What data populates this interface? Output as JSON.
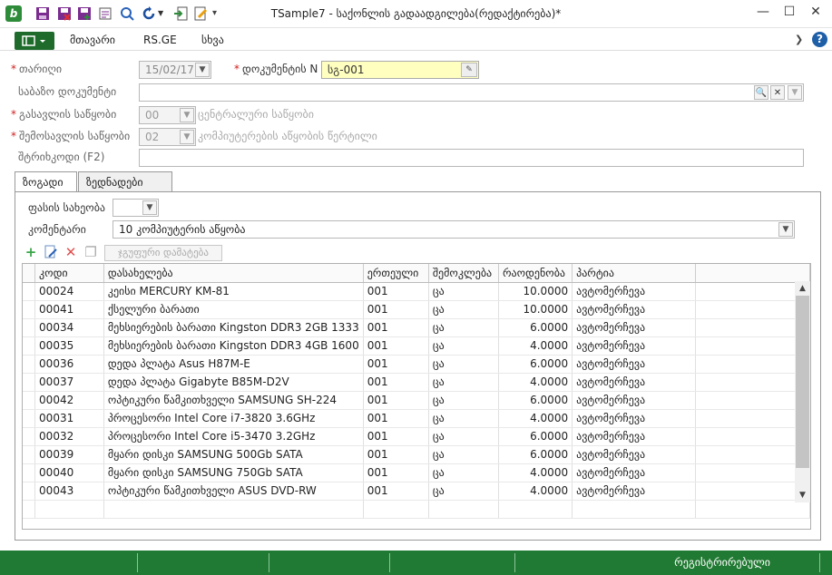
{
  "window": {
    "title": "TSample7 - საქონლის გადაადგილება(რედაქტირება)*"
  },
  "menu": {
    "items": [
      "მთავარი",
      "RS.GE",
      "სხვა"
    ]
  },
  "form": {
    "date_label": "თარიღი",
    "date_value": "15/02/17",
    "docnum_label": "დოკუმენტის N",
    "docnum_value": "სგ-001",
    "basedoc_label": "საბაზო დოკუმენტი",
    "out_label": "გასავლის საწყობი",
    "out_value": "00",
    "out_placeholder": "ცენტრალური საწყობი",
    "in_label": "შემოსავლის საწყობი",
    "in_value": "02",
    "in_placeholder": "კომპიუტერების აწყობის წერტილი",
    "barcode_label": "შტრიხკოდი (F2)"
  },
  "tabs": [
    "ზოგადი",
    "ზედნადები"
  ],
  "general": {
    "price_type_label": "ფასის სახეობა",
    "comment_label": "კომენტარი",
    "comment_value": "10 კომპიუტერის აწყობა",
    "group_add_label": "ჯგუფური დამატება"
  },
  "table": {
    "headers": [
      "კოდი",
      "დასახელება",
      "ერთეული",
      "შემოკლება",
      "რაოდენობა",
      "პარტია"
    ],
    "rows": [
      [
        "00024",
        "კეისი MERCURY KM-81",
        "001",
        "ცა",
        "10.0000",
        "ავტომერჩევა"
      ],
      [
        "00041",
        "ქსელური ბარათი",
        "001",
        "ცა",
        "10.0000",
        "ავტომერჩევა"
      ],
      [
        "00034",
        "მეხსიერების ბარათი Kingston DDR3 2GB 1333",
        "001",
        "ცა",
        "6.0000",
        "ავტომერჩევა"
      ],
      [
        "00035",
        "მეხსიერების ბარათი Kingston DDR3 4GB 1600",
        "001",
        "ცა",
        "4.0000",
        "ავტომერჩევა"
      ],
      [
        "00036",
        "დედა პლატა Asus H87M-E",
        "001",
        "ცა",
        "6.0000",
        "ავტომერჩევა"
      ],
      [
        "00037",
        "დედა პლატა Gigabyte B85M-D2V",
        "001",
        "ცა",
        "4.0000",
        "ავტომერჩევა"
      ],
      [
        "00042",
        "ოპტიკური წამკითხველი SAMSUNG SH-224",
        "001",
        "ცა",
        "6.0000",
        "ავტომერჩევა"
      ],
      [
        "00031",
        "პროცესორი Intel Core i7-3820 3.6GHz",
        "001",
        "ცა",
        "4.0000",
        "ავტომერჩევა"
      ],
      [
        "00032",
        "პროცესორი Intel Core i5-3470 3.2GHz",
        "001",
        "ცა",
        "6.0000",
        "ავტომერჩევა"
      ],
      [
        "00039",
        "მყარი დისკი SAMSUNG 500Gb SATA",
        "001",
        "ცა",
        "6.0000",
        "ავტომერჩევა"
      ],
      [
        "00040",
        "მყარი დისკი SAMSUNG 750Gb SATA",
        "001",
        "ცა",
        "4.0000",
        "ავტომერჩევა"
      ],
      [
        "00043",
        "ოპტიკური წამკითხველი ASUS DVD-RW",
        "001",
        "ცა",
        "4.0000",
        "ავტომერჩევა"
      ]
    ]
  },
  "status": {
    "text": "რეგისტრირებული"
  },
  "colors": {
    "accent": "#217a33",
    "required": "#d02020",
    "highlight": "#ffffc0"
  }
}
